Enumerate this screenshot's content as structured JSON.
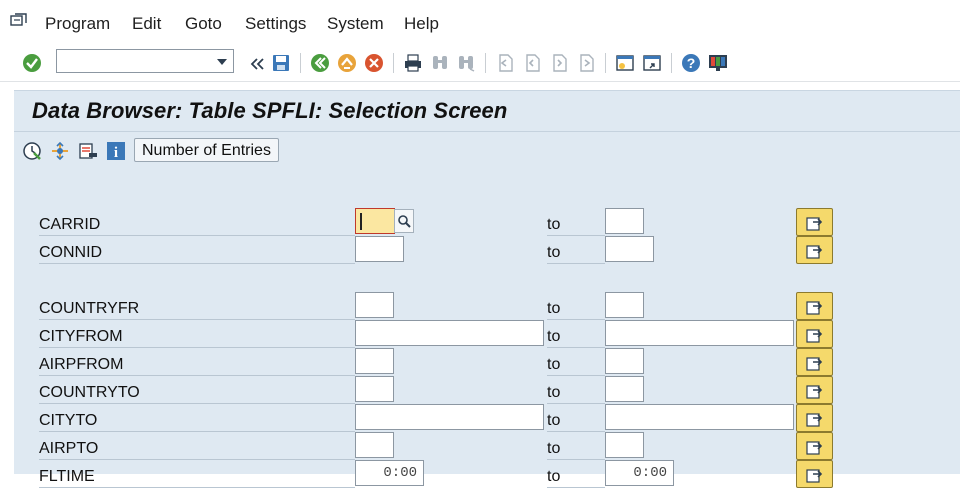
{
  "menu": {
    "items": [
      {
        "label": "Program"
      },
      {
        "label": "Edit"
      },
      {
        "label": "Goto"
      },
      {
        "label": "Settings"
      },
      {
        "label": "System"
      },
      {
        "label": "Help"
      }
    ]
  },
  "toolbar": {
    "command_field_value": "",
    "icons": [
      "enter-icon",
      "back-icon",
      "exit-icon",
      "cancel-icon",
      "print-icon",
      "find-icon",
      "find-next-icon",
      "first-page-icon",
      "previous-page-icon",
      "next-page-icon",
      "last-page-icon",
      "create-session-icon",
      "create-shortcut-icon",
      "help-icon",
      "customize-layout-icon"
    ]
  },
  "title": "Data Browser: Table SPFLI: Selection Screen",
  "app_toolbar": {
    "entries_button": "Number of Entries",
    "icons": [
      "execute-icon",
      "execute-background-icon",
      "delete-selection-icon",
      "info-icon"
    ]
  },
  "selection": {
    "to_label": "to",
    "rows": [
      {
        "field": "CARRID",
        "from": "",
        "to": ""
      },
      {
        "field": "CONNID",
        "from": "",
        "to": ""
      },
      {
        "field": "COUNTRYFR",
        "from": "",
        "to": ""
      },
      {
        "field": "CITYFROM",
        "from": "",
        "to": ""
      },
      {
        "field": "AIRPFROM",
        "from": "",
        "to": ""
      },
      {
        "field": "COUNTRYTO",
        "from": "",
        "to": ""
      },
      {
        "field": "CITYTO",
        "from": "",
        "to": ""
      },
      {
        "field": "AIRPTO",
        "from": "",
        "to": ""
      },
      {
        "field": "FLTIME",
        "from": "0:00",
        "to": "0:00"
      }
    ]
  },
  "colors": {
    "panel_bg": "#dfe9f2",
    "active_field": "#fbe7a1",
    "multi_select_button": "#f5d96b"
  }
}
